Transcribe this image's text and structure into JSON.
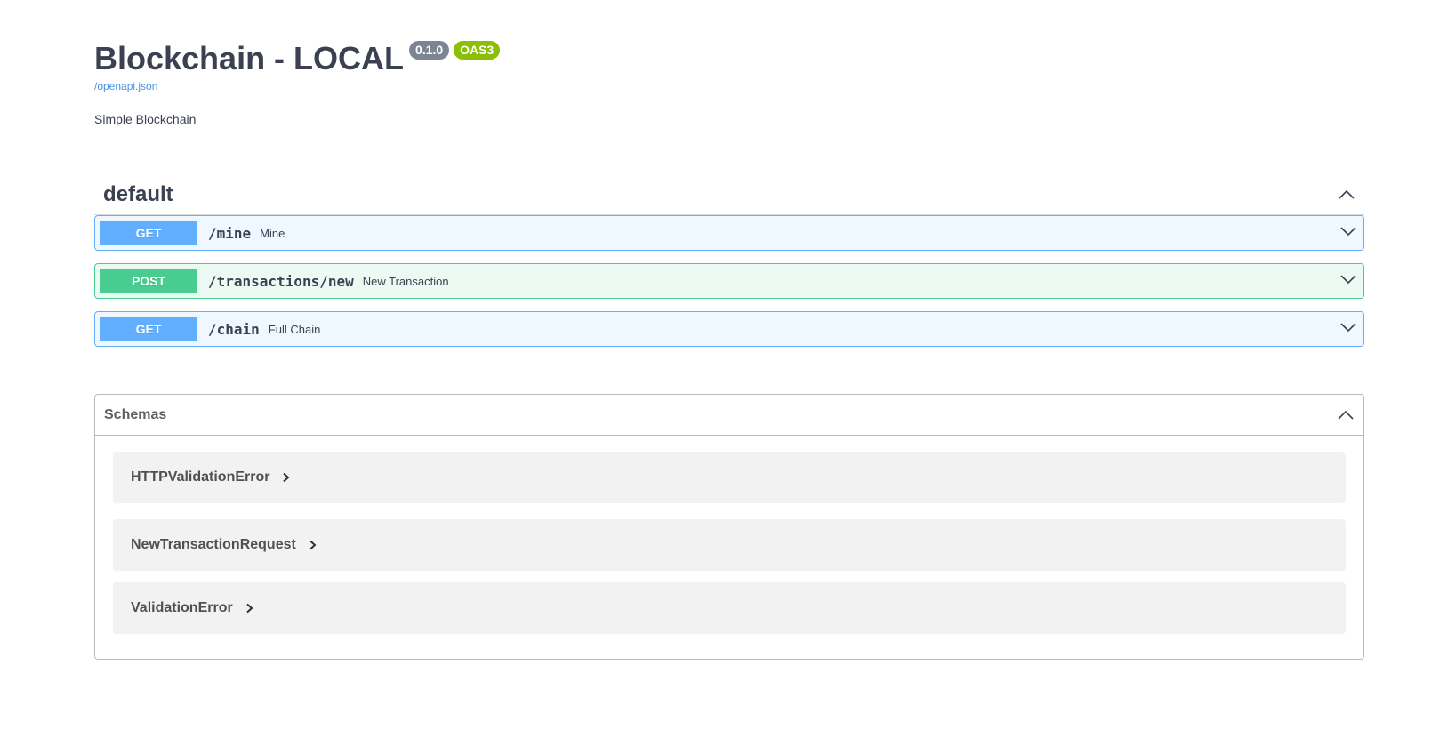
{
  "info": {
    "title": "Blockchain - LOCAL",
    "version": "0.1.0",
    "oas": "OAS3",
    "spec_url": "/openapi.json",
    "description": "Simple Blockchain"
  },
  "tag": {
    "name": "default",
    "expanded": true
  },
  "operations": [
    {
      "method": "GET",
      "path": "/mine",
      "summary": "Mine"
    },
    {
      "method": "POST",
      "path": "/transactions/new",
      "summary": "New Transaction"
    },
    {
      "method": "GET",
      "path": "/chain",
      "summary": "Full Chain"
    }
  ],
  "schemas": {
    "title": "Schemas",
    "items": [
      "HTTPValidationError",
      "NewTransactionRequest",
      "ValidationError"
    ]
  },
  "colors": {
    "get": "#61affe",
    "post": "#49cc90",
    "version_badge": "#7d8492",
    "oas_badge": "#89bf04",
    "link": "#4990e2"
  },
  "icons": {
    "collapse": "chevron-up-icon",
    "expand": "chevron-down-icon",
    "model_expand": "chevron-right-icon"
  }
}
